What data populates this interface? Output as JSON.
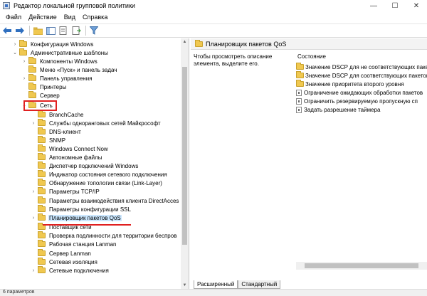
{
  "window": {
    "title": "Редактор локальной групповой политики",
    "minimize": "—",
    "maximize": "☐",
    "close": "✕"
  },
  "menu": [
    "Файл",
    "Действие",
    "Вид",
    "Справка"
  ],
  "tree": {
    "items": [
      {
        "label": "Конфигурация Windows",
        "expander": "›"
      },
      {
        "label": "Административные шаблоны",
        "expander": "⌄"
      },
      {
        "label": "Компоненты Windows",
        "expander": "›"
      },
      {
        "label": "Меню «Пуск» и панель задач",
        "expander": ""
      },
      {
        "label": "Панель управления",
        "expander": "›"
      },
      {
        "label": "Принтеры",
        "expander": ""
      },
      {
        "label": "Сервер",
        "expander": ""
      },
      {
        "label": "Сеть",
        "expander": "⌄"
      },
      {
        "label": "BranchCache",
        "expander": ""
      },
      {
        "label": "Службы одноранговых сетей Майкрософт",
        "expander": "›"
      },
      {
        "label": "DNS-клиент",
        "expander": ""
      },
      {
        "label": "SNMP",
        "expander": ""
      },
      {
        "label": "Windows Connect Now",
        "expander": ""
      },
      {
        "label": "Автономные файлы",
        "expander": ""
      },
      {
        "label": "Диспетчер подключений Windows",
        "expander": ""
      },
      {
        "label": "Индикатор состояния сетевого подключения",
        "expander": ""
      },
      {
        "label": "Обнаружение топологии связи (Link-Layer)",
        "expander": ""
      },
      {
        "label": "Параметры TCP/IP",
        "expander": "›"
      },
      {
        "label": "Параметры взаимодействия клиента DirectAcces",
        "expander": ""
      },
      {
        "label": "Параметры конфигурации SSL",
        "expander": ""
      },
      {
        "label": "Планировщик пакетов QoS",
        "expander": "›"
      },
      {
        "label": "Поставщик сети",
        "expander": ""
      },
      {
        "label": "Проверка подлинности для территории беспров",
        "expander": ""
      },
      {
        "label": "Рабочая станция Lanman",
        "expander": ""
      },
      {
        "label": "Сервер Lanman",
        "expander": ""
      },
      {
        "label": "Сетевая изоляция",
        "expander": ""
      },
      {
        "label": "Сетевые подключения",
        "expander": "›"
      }
    ]
  },
  "right": {
    "header": "Планировщик пакетов QoS",
    "description": "Чтобы просмотреть описание элемента, выделите его.",
    "column": "Состояние",
    "items": [
      {
        "label": "Значение DSCP для не соответствующих пакет",
        "type": "folder"
      },
      {
        "label": "Значение DSCP для соответствующих пакетов",
        "type": "folder"
      },
      {
        "label": "Значение приоритета второго уровня",
        "type": "folder"
      },
      {
        "label": "Ограничение ожидающих обработки пакетов",
        "type": "setting"
      },
      {
        "label": "Ограничить резервируемую пропускную сп",
        "type": "setting"
      },
      {
        "label": "Задать разрешение таймера",
        "type": "setting"
      }
    ]
  },
  "tabs": [
    "Расширенный",
    "Стандартный"
  ],
  "status": "6 параметров"
}
